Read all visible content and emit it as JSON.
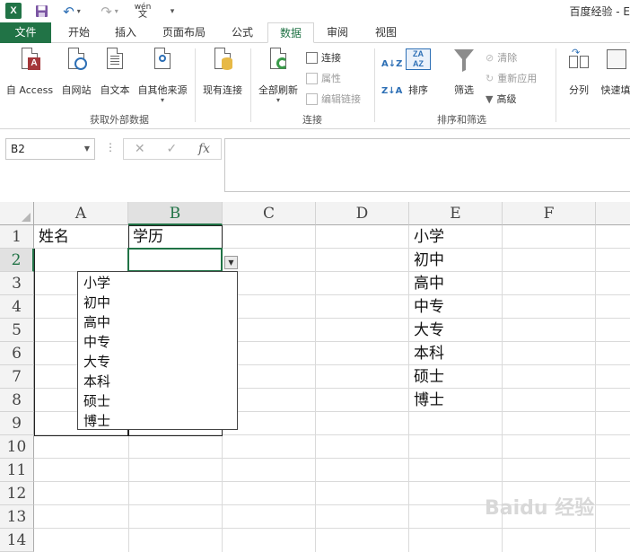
{
  "title_bar": {
    "app_icon": "X",
    "window_title": "百度经验 - E",
    "wen_top": "wén",
    "wen_bottom": "文"
  },
  "tabs": [
    {
      "label": "文件",
      "selected": false
    },
    {
      "label": "开始",
      "selected": false
    },
    {
      "label": "插入",
      "selected": false
    },
    {
      "label": "页面布局",
      "selected": false
    },
    {
      "label": "公式",
      "selected": false
    },
    {
      "label": "数据",
      "selected": true
    },
    {
      "label": "审阅",
      "selected": false
    },
    {
      "label": "视图",
      "selected": false
    }
  ],
  "ribbon": {
    "get_external": {
      "group_label": "获取外部数据",
      "from_access": "自 Access",
      "from_web": "自网站",
      "from_text": "自文本",
      "from_other": "自其他来源",
      "existing_connections": "现有连接"
    },
    "connections": {
      "group_label": "连接",
      "refresh_all": "全部刷新",
      "connections": "连接",
      "properties": "属性",
      "edit_links": "编辑链接"
    },
    "sort_filter": {
      "group_label": "排序和筛选",
      "sort": "排序",
      "filter": "筛选",
      "clear": "清除",
      "reapply": "重新应用",
      "advanced": "高级"
    },
    "data_tools": {
      "text_to_columns": "分列",
      "flash_fill": "快速填"
    }
  },
  "formula_bar": {
    "name_box": "B2",
    "cancel": "✕",
    "enter": "✓",
    "fx": "fx",
    "content": ""
  },
  "sheet": {
    "columns": [
      "A",
      "B",
      "C",
      "D",
      "E",
      "F"
    ],
    "rows": [
      "1",
      "2",
      "3",
      "4",
      "5",
      "6",
      "7",
      "8",
      "9",
      "10",
      "11",
      "12",
      "13",
      "14"
    ],
    "selected_cell": "B2",
    "A1": "姓名",
    "B1": "学历",
    "E_values": [
      "小学",
      "初中",
      "高中",
      "中专",
      "大专",
      "本科",
      "硕士",
      "博士"
    ]
  },
  "dropdown": {
    "options": [
      "小学",
      "初中",
      "高中",
      "中专",
      "大专",
      "本科",
      "硕士",
      "博士"
    ]
  },
  "watermark": "Baidu 经验"
}
